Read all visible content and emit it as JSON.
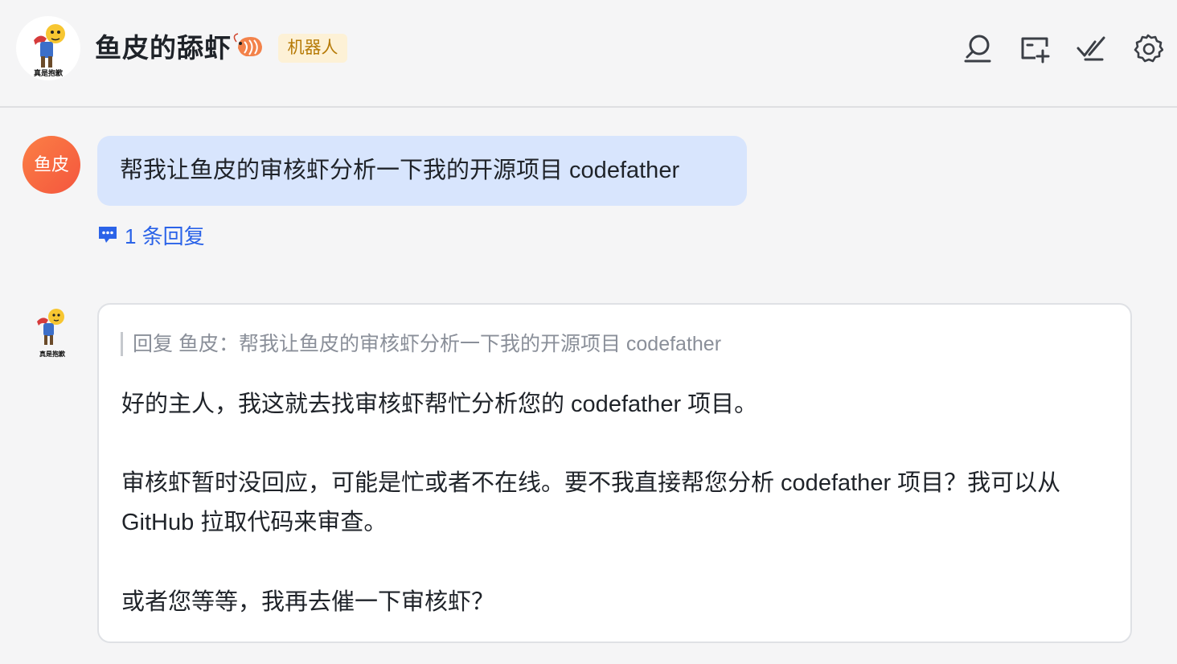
{
  "header": {
    "title": "鱼皮的舔虾",
    "badge": "机器人",
    "avatar_caption": "真是抱歉",
    "icons": [
      "search-icon",
      "new-chat-icon",
      "mark-done-icon",
      "settings-icon"
    ]
  },
  "messages": [
    {
      "avatar_text": "鱼皮",
      "text": "帮我让鱼皮的审核虾分析一下我的开源项目 codefather",
      "reply_count_label": "1 条回复"
    },
    {
      "avatar_caption": "真是抱歉",
      "quote": "回复 鱼皮：帮我让鱼皮的审核虾分析一下我的开源项目 codefather",
      "paragraphs": [
        "好的主人，我这就去找审核虾帮忙分析您的 codefather 项目。",
        "审核虾暂时没回应，可能是忙或者不在线。要不我直接帮您分析 codefather 项目？我可以从 GitHub 拉取代码来审查。",
        "或者您等等，我再去催一下审核虾？"
      ]
    }
  ],
  "colors": {
    "accent_blue": "#2b63e8",
    "bubble_bg": "#d8e5fd",
    "badge_bg": "#fdf1d6",
    "badge_text": "#b67a06",
    "avatar_orange": "#f4563e"
  }
}
